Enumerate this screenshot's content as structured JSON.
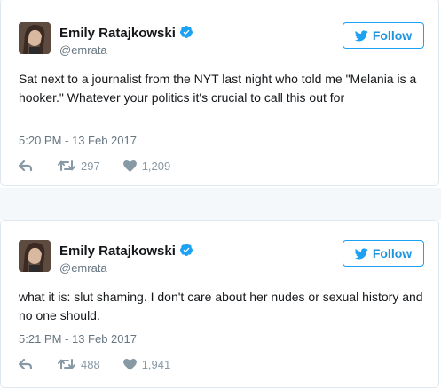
{
  "tweets": [
    {
      "name": "Emily Ratajkowski",
      "handle": "@emrata",
      "follow_label": "Follow",
      "text": "Sat next to a journalist from the NYT last night who told me \"Melania is a hooker.\" Whatever your politics it's crucial to call this out for",
      "timestamp": "5:20 PM - 13 Feb 2017",
      "retweets": "297",
      "likes": "1,209"
    },
    {
      "name": "Emily Ratajkowski",
      "handle": "@emrata",
      "follow_label": "Follow",
      "text": "what it is: slut shaming. I don't care about her nudes or sexual history and no one should.",
      "timestamp": "5:21 PM - 13 Feb 2017",
      "retweets": "488",
      "likes": "1,941"
    }
  ],
  "colors": {
    "accent": "#1da1f2",
    "muted": "#66757f",
    "icon": "#8899a6",
    "verified": "#1da1f2"
  },
  "icons": [
    "avatar",
    "verified-badge-icon",
    "twitter-bird-icon",
    "reply-icon",
    "retweet-icon",
    "heart-icon"
  ]
}
